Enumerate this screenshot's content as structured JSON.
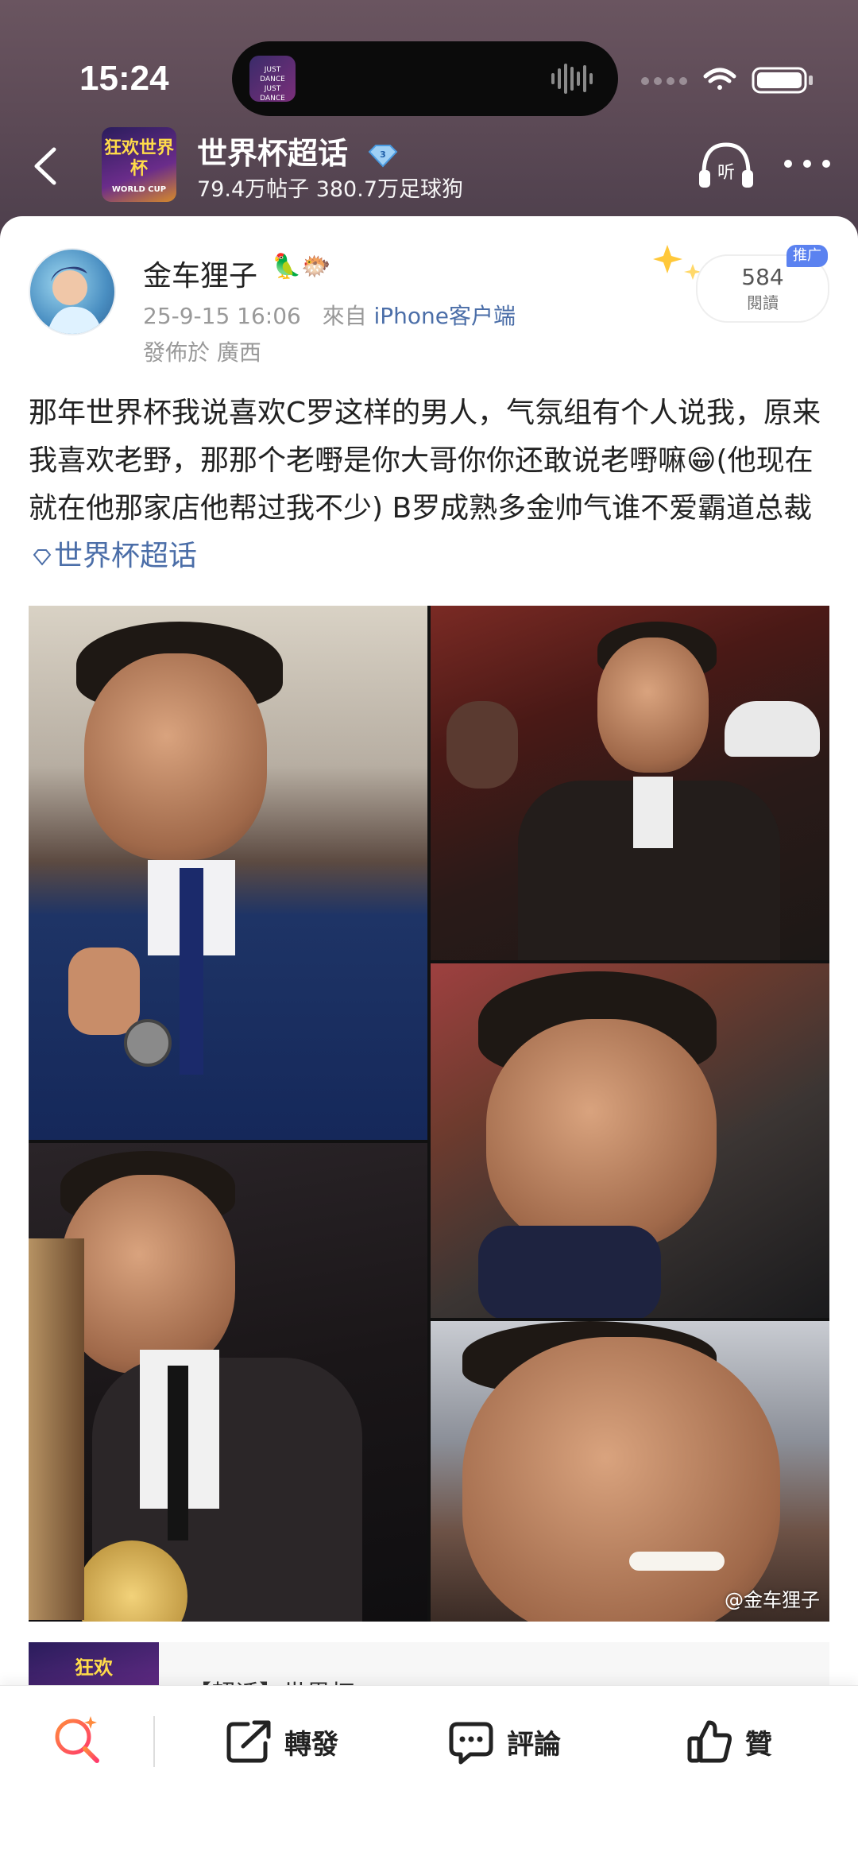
{
  "status_bar": {
    "time": "15:24",
    "island_art_text": "JUST DANCE\nJUST DANCE",
    "icons": [
      "signal-dots-icon",
      "wifi-icon",
      "battery-icon"
    ]
  },
  "nav": {
    "group_title": "世界杯超话",
    "group_stats": "79.4万帖子 380.7万足球狗",
    "logo_text": "狂欢世界杯",
    "logo_sub": "WORLD CUP"
  },
  "post": {
    "username": "金车狸子",
    "timestamp": "25-9-15 16:06",
    "source_prefix": "來自",
    "source": "iPhone客户端",
    "location": "發佈於 廣西",
    "read_count": "584",
    "read_label": "閱讀",
    "ad_tag": "推广",
    "body": "那年世界杯我说喜欢C罗这样的男人，气氛组有个人说我，原来我喜欢老野，那那个老嘢是你大哥你你还敢说老嘢嘛😁(他现在就在他那家店他帮过我不少) B罗成熟多金帅气谁不爱霸道总裁",
    "topic_link": "世界杯超话",
    "watermark": "@金车狸子"
  },
  "preview": {
    "thumb_text": "狂欢",
    "title": "【超话】世界杯"
  },
  "action_bar": {
    "forward": "轉發",
    "comment": "評論",
    "like": "贊"
  }
}
